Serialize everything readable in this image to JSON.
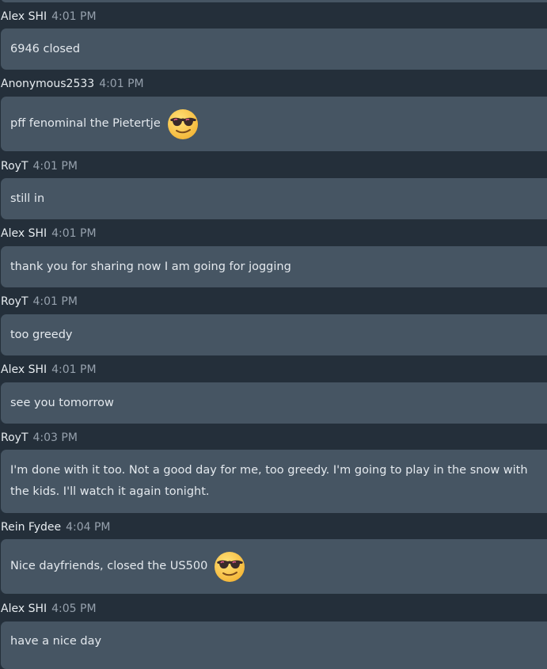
{
  "messages": [
    {
      "author": "Alex SHI",
      "time": "4:01 PM",
      "text": "6946 closed"
    },
    {
      "author": "Anonymous2533",
      "time": "4:01 PM",
      "text": "pff fenominal the Pietertje",
      "emoji": "smiling-face-with-sunglasses-icon"
    },
    {
      "author": "RoyT",
      "time": "4:01 PM",
      "text": "still in"
    },
    {
      "author": "Alex SHI",
      "time": "4:01 PM",
      "text": "thank you for sharing now I am going for jogging"
    },
    {
      "author": "RoyT",
      "time": "4:01 PM",
      "text": "too greedy"
    },
    {
      "author": "Alex SHI",
      "time": "4:01 PM",
      "text": "see you tomorrow"
    },
    {
      "author": "RoyT",
      "time": "4:03 PM",
      "text": "I'm done with it too. Not a good day for me, too greedy. I'm going to play in the snow with the kids. I'll watch it again tonight."
    },
    {
      "author": "Rein Fydee",
      "time": "4:04 PM",
      "text": "Nice dayfriends, closed the US500",
      "emoji": "smiling-face-with-sunglasses-icon"
    },
    {
      "author": "Alex SHI",
      "time": "4:05 PM",
      "text": "have a nice day"
    }
  ],
  "colors": {
    "background": "#242f3a",
    "bubble": "#465563",
    "author": "#e7ecf0",
    "time": "#96a1ad",
    "text": "#e4e9ee"
  }
}
